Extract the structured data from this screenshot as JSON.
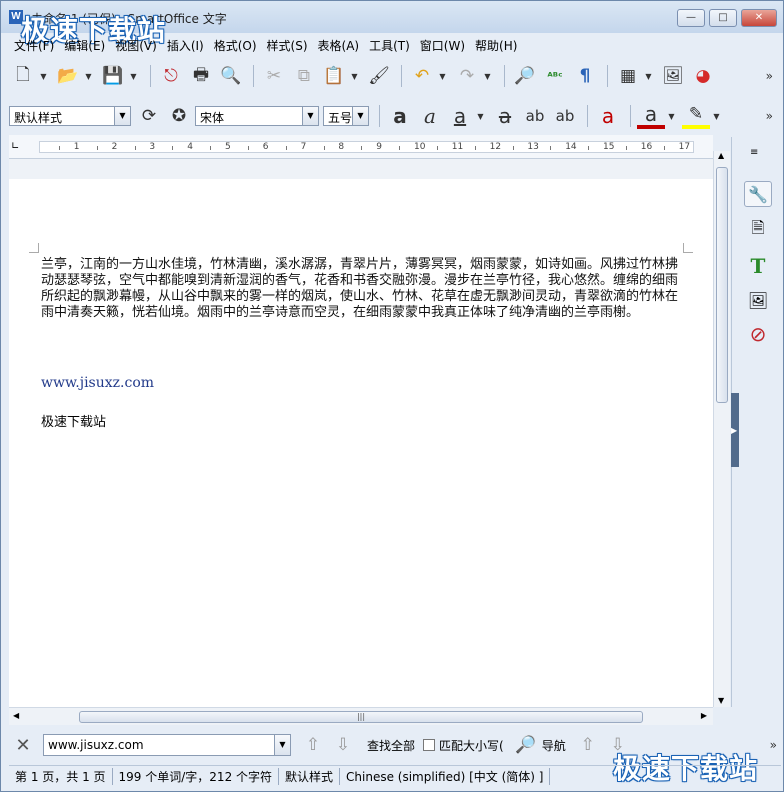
{
  "window": {
    "title": "未命名 1 (已保) - SmartOffice 文字",
    "icon_letter": "W",
    "watermark": "极速下载站",
    "buttons": {
      "minimize": "—",
      "maximize": "□",
      "close": "✕"
    }
  },
  "menu": [
    "文件(F)",
    "编辑(E)",
    "视图(V)",
    "插入(I)",
    "格式(O)",
    "样式(S)",
    "表格(A)",
    "工具(T)",
    "窗口(W)",
    "帮助(H)"
  ],
  "toolbar1": [
    {
      "name": "new-document-icon",
      "glyph": "🗋"
    },
    {
      "name": "open-folder-icon",
      "glyph": "📂"
    },
    {
      "name": "save-icon",
      "glyph": "💾"
    },
    {
      "name": "export-pdf-icon",
      "glyph": "⎋"
    },
    {
      "name": "print-icon",
      "glyph": "🖶"
    },
    {
      "name": "print-preview-icon",
      "glyph": "🔍"
    },
    {
      "name": "cut-icon",
      "glyph": "✂"
    },
    {
      "name": "copy-icon",
      "glyph": "⧉"
    },
    {
      "name": "paste-icon",
      "glyph": "📋"
    },
    {
      "name": "format-paintbrush-icon",
      "glyph": "🖌"
    },
    {
      "name": "undo-icon",
      "glyph": "↶"
    },
    {
      "name": "redo-icon",
      "glyph": "↷"
    },
    {
      "name": "find-replace-icon",
      "glyph": "🔎"
    },
    {
      "name": "spellcheck-icon",
      "glyph": "ᴬᴮᶜ"
    },
    {
      "name": "pilcrow-icon",
      "glyph": "¶"
    },
    {
      "name": "table-icon",
      "glyph": "▦"
    },
    {
      "name": "image-icon",
      "glyph": "🖼"
    },
    {
      "name": "chart-icon",
      "glyph": "◕"
    }
  ],
  "toolbar2": {
    "style_value": "默认样式",
    "font_value": "宋体",
    "size_value": "五号",
    "buttons": [
      {
        "name": "bold-icon",
        "glyph": "a"
      },
      {
        "name": "italic-icon",
        "glyph": "a"
      },
      {
        "name": "underline-icon",
        "glyph": "a"
      },
      {
        "name": "strikethrough-icon",
        "glyph": "a"
      },
      {
        "name": "superscript-icon",
        "glyph": "ab"
      },
      {
        "name": "subscript-icon",
        "glyph": "ab"
      },
      {
        "name": "clear-format-icon",
        "glyph": "a"
      },
      {
        "name": "font-color-icon",
        "glyph": "a"
      },
      {
        "name": "highlight-icon",
        "glyph": "✎"
      }
    ]
  },
  "ruler": {
    "numbers": [
      "1",
      "2",
      "3",
      "4",
      "5",
      "6",
      "7",
      "8",
      "9",
      "10",
      "11",
      "12",
      "13",
      "14",
      "15",
      "16",
      "17"
    ]
  },
  "document": {
    "paragraph": "兰亭，江南的一方山水佳境，竹林清幽，溪水潺潺，青翠片片，薄雾冥冥，烟雨蒙蒙，如诗如画。风拂过竹林拂动瑟瑟琴弦，空气中都能嗅到清新湿润的香气，花香和书香交融弥漫。漫步在兰亭竹径，我心悠然。缠绵的细雨所织起的飘渺幕幔，从山谷中飘来的雾一样的烟岚，使山水、竹林、花草在虚无飘渺间灵动，青翠欲滴的竹林在雨中清奏天籁，恍若仙境。烟雨中的兰亭诗意而空灵，在细雨蒙蒙中我真正体味了纯净清幽的兰亭雨榭。",
    "link": "www.jisuxz.com",
    "line3": "极速下载站"
  },
  "sidebar": [
    {
      "name": "properties-wrench-icon",
      "glyph": "🔧"
    },
    {
      "name": "page-icon",
      "glyph": "🗎"
    },
    {
      "name": "styles-text-icon",
      "glyph": "T"
    },
    {
      "name": "gallery-icon",
      "glyph": "🖼"
    },
    {
      "name": "navigator-compass-icon",
      "glyph": "⊘"
    }
  ],
  "findbar": {
    "value": "www.jisuxz.com",
    "find_all": "查找全部",
    "match_case": "匹配大小写(",
    "navigate": "导航"
  },
  "status": {
    "page": "第 1 页，共 1 页",
    "words": "199 个单词/字，212 个字符",
    "style": "默认样式",
    "language": "Chinese (simplified) [中文 (简体) ]"
  },
  "colors": {
    "accent": "#2a64b8",
    "font_color": "#c00000",
    "highlight": "#ffff00"
  }
}
